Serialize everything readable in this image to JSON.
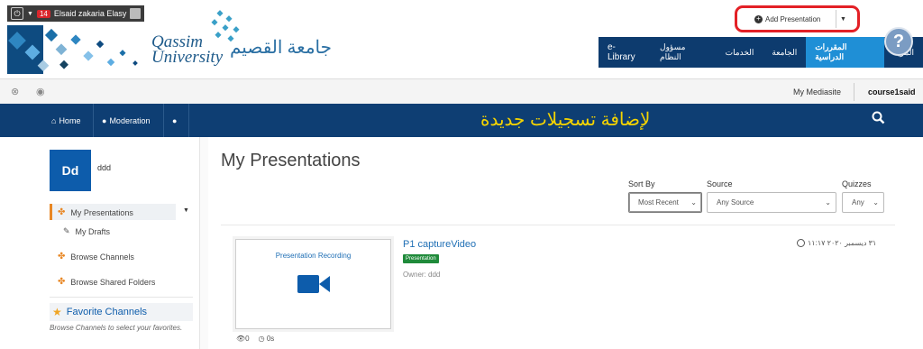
{
  "colors": {
    "top_nav_bg": "#0d3b6e",
    "top_nav_active": "#1f8fd6",
    "main_nav_bg": "#0e3e73",
    "accent_orange": "#e88724",
    "highlight_red": "#e32026",
    "note_yellow": "#f5d400",
    "brand_blue": "#0d5cab",
    "badge_green": "#1f8a3a"
  },
  "user_bar": {
    "power_icon": "power-icon",
    "notification_count": "14",
    "user_name": "Elsaid zakaria Elasy"
  },
  "logo": {
    "en_line1": "Qassim",
    "en_line2": "University",
    "ar": "جامعة القصيم"
  },
  "top_nav": {
    "items": [
      {
        "label": "e-Library"
      },
      {
        "label": "مسؤول النظام"
      },
      {
        "label": "الخدمات"
      },
      {
        "label": "الجامعة"
      },
      {
        "label": "المقررات الدراسية"
      },
      {
        "label": "المزيد"
      }
    ],
    "help_label": "?"
  },
  "subbar": {
    "my_mediasite": "My Mediasite",
    "username": "course1said"
  },
  "main_nav": {
    "home": "Home",
    "moderation": "Moderation",
    "annotation": "لإضافة تسجيلات جديدة",
    "add_presentation": "Add Presentation"
  },
  "sidebar": {
    "initials": "Dd",
    "name": "ddd",
    "items": [
      {
        "label": "My Presentations"
      },
      {
        "label": "My Drafts"
      },
      {
        "label": "Browse Channels"
      },
      {
        "label": "Browse Shared Folders"
      }
    ],
    "favorites_title": "Favorite Channels",
    "favorites_hint": "Browse Channels to select your favorites."
  },
  "main": {
    "title": "My Presentations",
    "filters": [
      {
        "label": "Sort By",
        "value": "Most Recent"
      },
      {
        "label": "Source",
        "value": "Any Source"
      },
      {
        "label": "Quizzes",
        "value": "Any"
      }
    ],
    "presentation": {
      "thumb_caption": "Presentation Recording",
      "title": "P1 captureVideo",
      "badge": "Presentation",
      "owner": "Owner: ddd",
      "views": "0",
      "duration": "0s",
      "date": "٣١ ديسمبر ٢٠٢٠ ١١:١٧"
    }
  }
}
